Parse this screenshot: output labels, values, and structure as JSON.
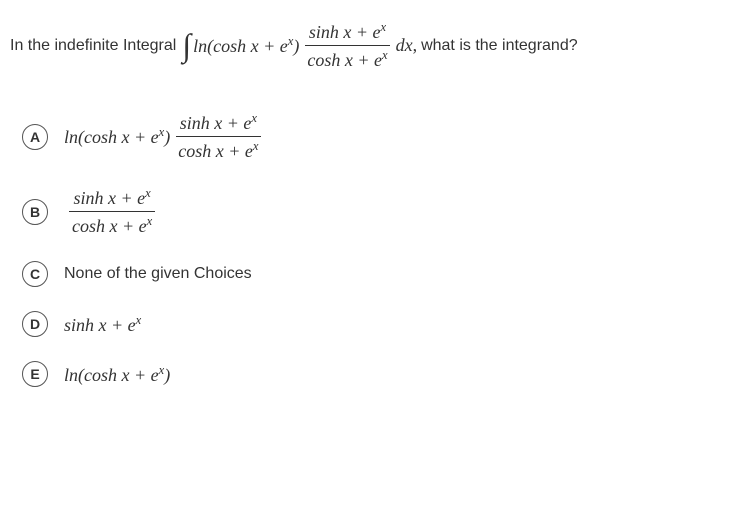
{
  "question": {
    "prefix": "In the indefinite Integral",
    "ln_part": "ln(cosh",
    "var_x": "x",
    "plus": " + ",
    "e_base": "e",
    "exp_x": "x",
    "close_paren": ")",
    "frac_num_sinh": "sinh x + e",
    "frac_den_cosh": "cosh x + e",
    "dx": "dx",
    "comma": ",",
    "suffix": "what is the integrand?"
  },
  "options": [
    {
      "letter": "A",
      "type": "math_full",
      "ln_part": "ln(cosh x + e",
      "close": ")",
      "frac_num": "sinh x + e",
      "frac_den": "cosh x + e"
    },
    {
      "letter": "B",
      "type": "math_frac",
      "frac_num": "sinh x + e",
      "frac_den": "cosh x + e"
    },
    {
      "letter": "C",
      "type": "plain",
      "text": "None of the given Choices"
    },
    {
      "letter": "D",
      "type": "math_simple",
      "text": "sinh x + e"
    },
    {
      "letter": "E",
      "type": "math_ln",
      "text": "ln(cosh x + e",
      "close": ")"
    }
  ]
}
